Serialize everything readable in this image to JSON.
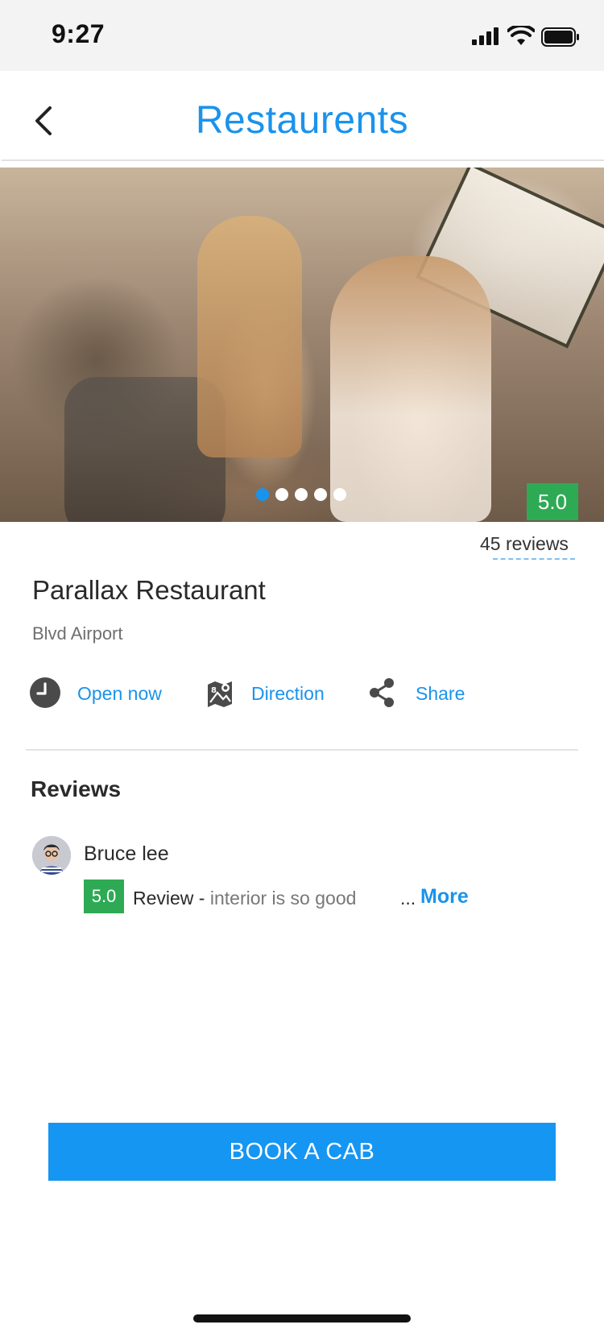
{
  "status_bar": {
    "time": "9:27"
  },
  "header": {
    "title": "Restaurents"
  },
  "gallery": {
    "image_count": 5,
    "active_index": 0,
    "rating": "5.0"
  },
  "summary": {
    "reviews_count_label": "45 reviews"
  },
  "restaurant": {
    "name": "Parallax Restaurant",
    "location": "Blvd Airport"
  },
  "actions": [
    {
      "label": "Open now",
      "icon": "clock-icon"
    },
    {
      "label": "Direction",
      "icon": "map-icon"
    },
    {
      "label": "Share",
      "icon": "share-icon"
    }
  ],
  "reviews": {
    "heading": "Reviews",
    "items": [
      {
        "name": "Bruce lee",
        "rating": "5.0",
        "label": "Review -",
        "text": "interior is so good",
        "ellipsis": "...",
        "more": "More"
      }
    ]
  },
  "cta": {
    "label": "BOOK A CAB"
  },
  "colors": {
    "accent": "#1A93EC",
    "rating_green": "#2EAA55",
    "button_blue": "#1596F2"
  }
}
